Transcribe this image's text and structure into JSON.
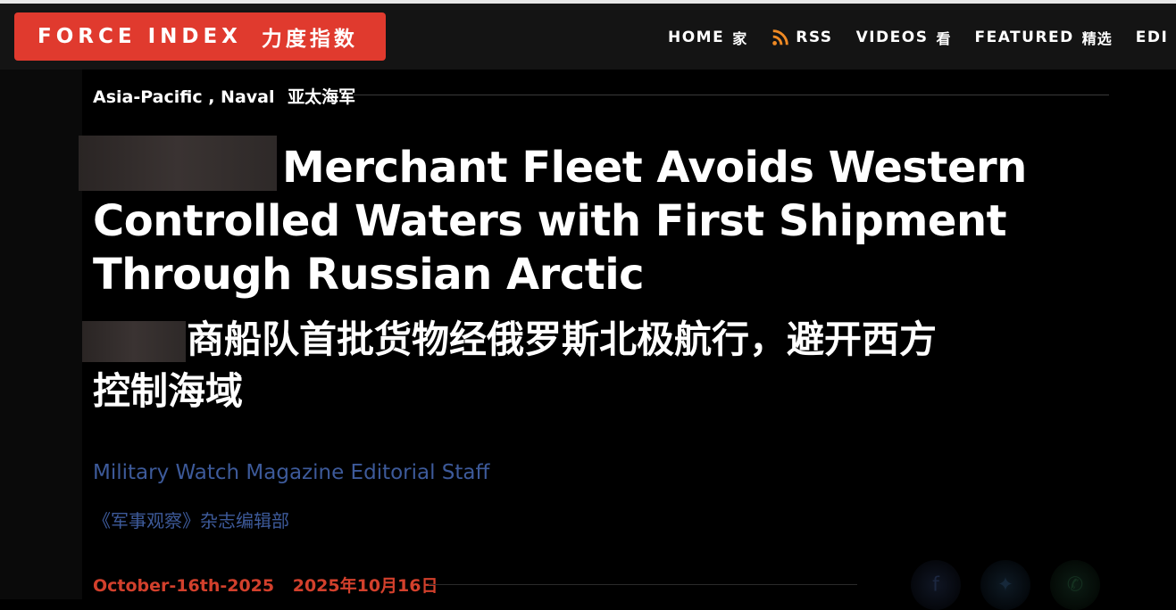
{
  "brand": {
    "name_en": "FORCE INDEX",
    "name_zh": "力度指数"
  },
  "nav": [
    {
      "label": "HOME",
      "zh": "家",
      "icon": ""
    },
    {
      "label": "RSS",
      "zh": "",
      "icon": "rss-icon"
    },
    {
      "label": "VIDEOS",
      "zh": "看",
      "icon": ""
    },
    {
      "label": "FEATURED",
      "zh": "精选",
      "icon": ""
    },
    {
      "label": "EDI",
      "zh": "",
      "icon": ""
    }
  ],
  "article": {
    "category_en": "Asia-Pacific , Naval",
    "category_zh": "亚太海军",
    "title_en": "Merchant Fleet Avoids Western Controlled Waters with First Shipment Through Russian Arctic",
    "title_zh": "商船队首批货物经俄罗斯北极航行，避开西方控制海域",
    "author_en": "Military Watch Magazine Editorial Staff",
    "author_zh": "《军事观察》杂志编辑部",
    "date_en": "October-16th-2025",
    "date_zh": "2025年10月16日"
  },
  "colors": {
    "brand_red": "#e03a2e",
    "author_blue": "#3d5a9a",
    "date_red": "#d2402c",
    "rss_orange": "#f08a24"
  },
  "share_icons": [
    "facebook-icon",
    "twitter-icon",
    "whatsapp-icon"
  ]
}
